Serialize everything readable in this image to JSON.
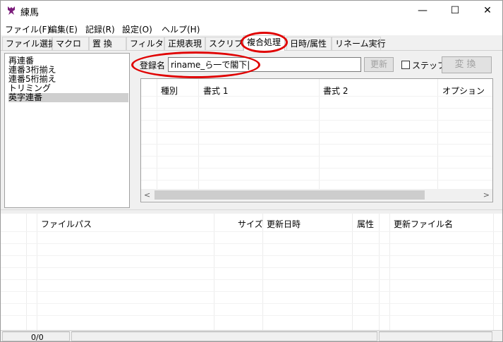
{
  "window": {
    "title": "練馬",
    "controls": {
      "minimize": "—",
      "maximize": "☐",
      "close": "✕"
    },
    "accent_color": "#7a1b7a"
  },
  "menu": [
    {
      "label": "ファイル(F)"
    },
    {
      "label": "編集(E)"
    },
    {
      "label": "記録(R)"
    },
    {
      "label": "設定(O)"
    },
    {
      "label": "ヘルプ(H)"
    }
  ],
  "tabs": [
    {
      "label": "ファイル選択"
    },
    {
      "label": "マクロ"
    },
    {
      "label": "置 換"
    },
    {
      "label": "フィルタ"
    },
    {
      "label": "正規表現"
    },
    {
      "label": "スクリプト"
    },
    {
      "label": "複合処理",
      "active": true
    },
    {
      "label": "日時/属性"
    },
    {
      "label": "リネーム実行"
    }
  ],
  "preset_list": [
    {
      "label": "再連番"
    },
    {
      "label": "連番3桁揃え"
    },
    {
      "label": "連番5桁揃え"
    },
    {
      "label": "トリミング"
    },
    {
      "label": "英字連番",
      "selected": true
    }
  ],
  "registration": {
    "label": "登録名",
    "value": "riname_ら一で閣下|",
    "update_button": "更新",
    "step_label": "ステップ",
    "step_checked": false,
    "convert_button": "変換"
  },
  "rule_table": {
    "columns": [
      "種別",
      "書式 1",
      "書式 2",
      "オプション"
    ],
    "scroll_left": "<",
    "scroll_right": ">"
  },
  "file_table": {
    "columns": [
      "ファイルパス",
      "サイズ",
      "更新日時",
      "属性",
      "更新ファイル名"
    ]
  },
  "status": {
    "count": "0/0"
  },
  "annotation_color": "#e00000"
}
